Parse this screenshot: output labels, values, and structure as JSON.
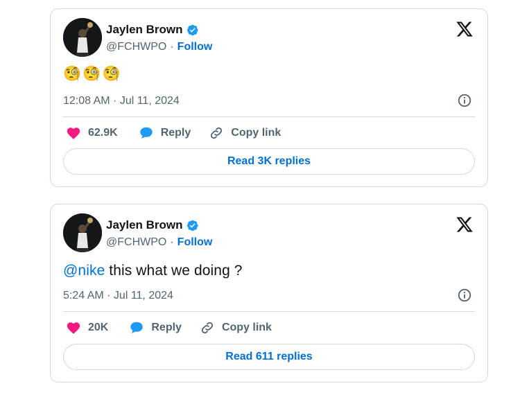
{
  "tweets": [
    {
      "author_name": "Jaylen Brown",
      "handle": "@FCHWPO",
      "separator": "·",
      "follow_label": "Follow",
      "emojis": [
        "🧐",
        "🧐",
        "🧐"
      ],
      "timestamp": "12:08 AM · Jul 11, 2024",
      "likes": "62.9K",
      "reply_label": "Reply",
      "copy_link_label": "Copy link",
      "read_replies_label": "Read 3K replies"
    },
    {
      "author_name": "Jaylen Brown",
      "handle": "@FCHWPO",
      "separator": "·",
      "follow_label": "Follow",
      "mention": "@nike",
      "text": " this what we doing ?",
      "timestamp": "5:24 AM · Jul 11, 2024",
      "likes": "20K",
      "reply_label": "Reply",
      "copy_link_label": "Copy link",
      "read_replies_label": "Read 611 replies"
    }
  ],
  "colors": {
    "link_blue": "#006fd6",
    "like_pink": "#f91880",
    "reply_blue": "#1d9bf0",
    "border": "#cfd9de",
    "muted": "#536471"
  },
  "icons": [
    "verified-badge-icon",
    "x-logo-icon",
    "info-icon",
    "heart-icon",
    "reply-bubble-icon",
    "link-icon"
  ]
}
